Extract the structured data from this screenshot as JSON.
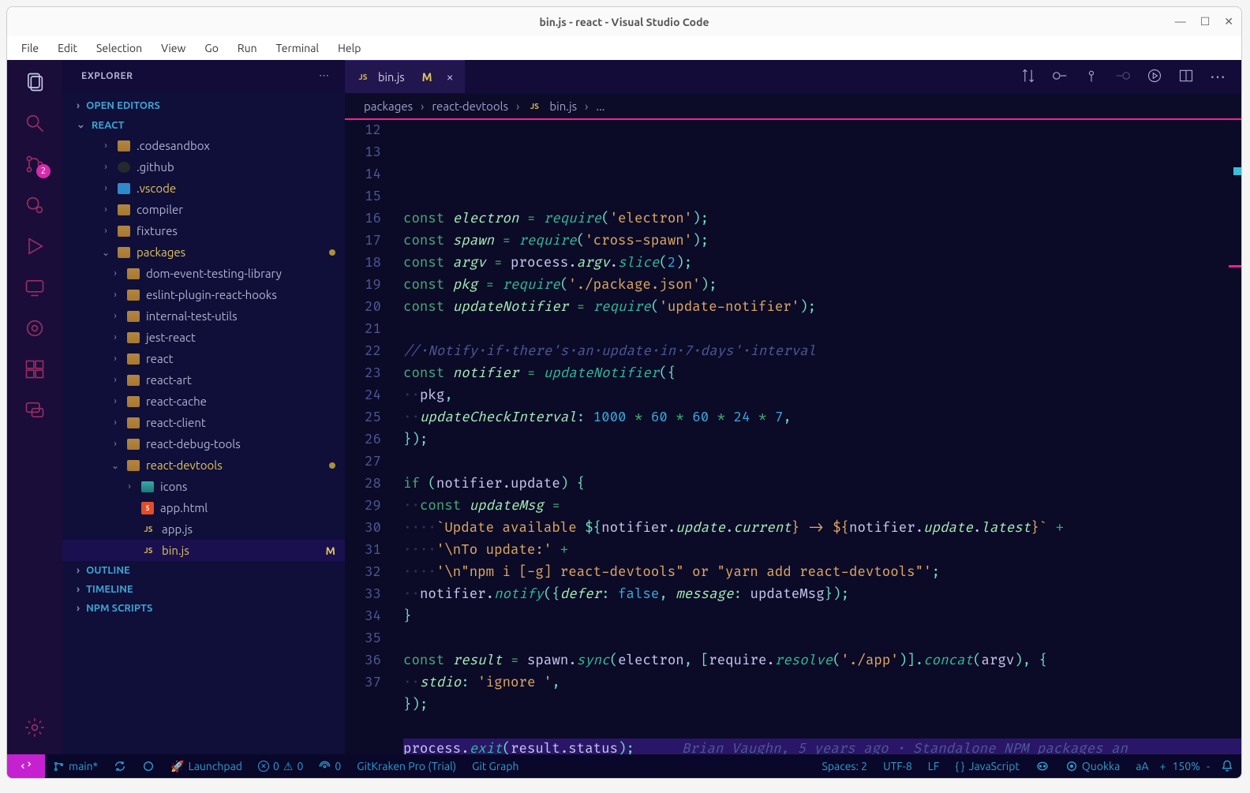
{
  "window": {
    "title": "bin.js - react - Visual Studio Code"
  },
  "menubar": [
    "File",
    "Edit",
    "Selection",
    "View",
    "Go",
    "Run",
    "Terminal",
    "Help"
  ],
  "sidebar": {
    "title": "EXPLORER",
    "sections": {
      "open_editors": "OPEN EDITORS",
      "root": "REACT",
      "outline": "OUTLINE",
      "timeline": "TIMELINE",
      "npm": "NPM SCRIPTS"
    },
    "tree": [
      {
        "type": "folder",
        "name": ".codesandbox",
        "indent": 2
      },
      {
        "type": "folder",
        "name": ".github",
        "indent": 2,
        "iconHint": "github"
      },
      {
        "type": "folder",
        "name": ".vscode",
        "indent": 2,
        "modified": true,
        "iconHint": "vscode"
      },
      {
        "type": "folder",
        "name": "compiler",
        "indent": 2
      },
      {
        "type": "folder",
        "name": "fixtures",
        "indent": 2
      },
      {
        "type": "folder",
        "name": "packages",
        "indent": 2,
        "expanded": true,
        "modified": true,
        "dot": true
      },
      {
        "type": "folder",
        "name": "dom-event-testing-library",
        "indent": 3
      },
      {
        "type": "folder",
        "name": "eslint-plugin-react-hooks",
        "indent": 3
      },
      {
        "type": "folder",
        "name": "internal-test-utils",
        "indent": 3
      },
      {
        "type": "folder",
        "name": "jest-react",
        "indent": 3
      },
      {
        "type": "folder",
        "name": "react",
        "indent": 3
      },
      {
        "type": "folder",
        "name": "react-art",
        "indent": 3
      },
      {
        "type": "folder",
        "name": "react-cache",
        "indent": 3
      },
      {
        "type": "folder",
        "name": "react-client",
        "indent": 3
      },
      {
        "type": "folder",
        "name": "react-debug-tools",
        "indent": 3
      },
      {
        "type": "folder",
        "name": "react-devtools",
        "indent": 3,
        "expanded": true,
        "modified": true,
        "dot": true
      },
      {
        "type": "folder",
        "name": "icons",
        "indent": 4,
        "iconHint": "icons"
      },
      {
        "type": "file",
        "name": "app.html",
        "indent": 4,
        "icon": "html"
      },
      {
        "type": "file",
        "name": "app.js",
        "indent": 4,
        "icon": "js"
      },
      {
        "type": "file",
        "name": "bin.js",
        "indent": 4,
        "icon": "js",
        "modified": true,
        "selected": true,
        "mBadge": "M"
      }
    ]
  },
  "scm_badge": "2",
  "tab": {
    "icon": "JS",
    "name": "bin.js",
    "m": "M"
  },
  "breadcrumb": [
    "packages",
    "react-devtools",
    "bin.js",
    "..."
  ],
  "breadcrumb_file_icon": "JS",
  "line_start": 12,
  "line_end": 37,
  "code": {
    "l12": {
      "kw": "const",
      "v": "electron",
      "eq": "=",
      "fn": "require",
      "s": "'electron'"
    },
    "l13": {
      "kw": "const",
      "v": "spawn",
      "eq": "=",
      "fn": "require",
      "s": "'cross-spawn'"
    },
    "l14": {
      "kw": "const",
      "v": "argv",
      "eq": "=",
      "obj": "process",
      "prop": "argv",
      "meth": "slice",
      "num": "2"
    },
    "l15": {
      "kw": "const",
      "v": "pkg",
      "eq": "=",
      "fn": "require",
      "s": "'./package.json'"
    },
    "l16": {
      "kw": "const",
      "v": "updateNotifier",
      "eq": "=",
      "fn": "require",
      "s": "'update-notifier'"
    },
    "l18": {
      "comment": "// Notify if there's an update in 7 days' interval"
    },
    "l19": {
      "kw": "const",
      "v": "notifier",
      "eq": "=",
      "fn": "updateNotifier"
    },
    "l20": {
      "id": "pkg"
    },
    "l21": {
      "prop": "updateCheckInterval",
      "nums": [
        "1000",
        "60",
        "60",
        "24",
        "7"
      ]
    },
    "l24": {
      "kw": "if",
      "obj": "notifier",
      "prop": "update"
    },
    "l25": {
      "kw": "const",
      "v": "updateMsg",
      "eq": "="
    },
    "l26": {
      "t1": "`Update available ",
      "t2": "${",
      "o1": "notifier",
      "p1": "update",
      "p2": "current",
      "t3": "} -> ${",
      "o2": "notifier",
      "p3": "update",
      "p4": "latest",
      "t4": "}`"
    },
    "l27": {
      "s": "'\\nTo update:'"
    },
    "l28": {
      "s": "'\\n\"npm i [-g] react-devtools\" or \"yarn add react-devtools\"'"
    },
    "l29": {
      "o": "notifier",
      "m": "notify",
      "p1": "defer",
      "v1": "false",
      "p2": "message",
      "id": "updateMsg"
    },
    "l32": {
      "kw": "const",
      "v": "result",
      "eq": "=",
      "o": "spawn",
      "m": "sync",
      "a1": "electron",
      "r": "require",
      "rm": "resolve",
      "s": "'./app'",
      "cc": "concat",
      "a2": "argv"
    },
    "l33": {
      "p": "stdio",
      "s": "'ignore '"
    },
    "l36": {
      "o": "process",
      "m": "exit",
      "a": "result",
      "p": "status",
      "blame": "Brian Vaughn, 5 years ago · Standalone NPM packages an"
    }
  },
  "statusbar": {
    "branch": "main*",
    "launchpad": "Launchpad",
    "errors": "0",
    "warnings": "0",
    "radio": "0",
    "gitkraken": "GitKraken Pro (Trial)",
    "gitgraph": "Git Graph",
    "spaces": "Spaces: 2",
    "encoding": "UTF-8",
    "eol": "LF",
    "lang": "JavaScript",
    "quokka": "Quokka",
    "aa": "aA",
    "zoom_plus": "+",
    "zoom": "150%",
    "zoom_minus": "-"
  }
}
